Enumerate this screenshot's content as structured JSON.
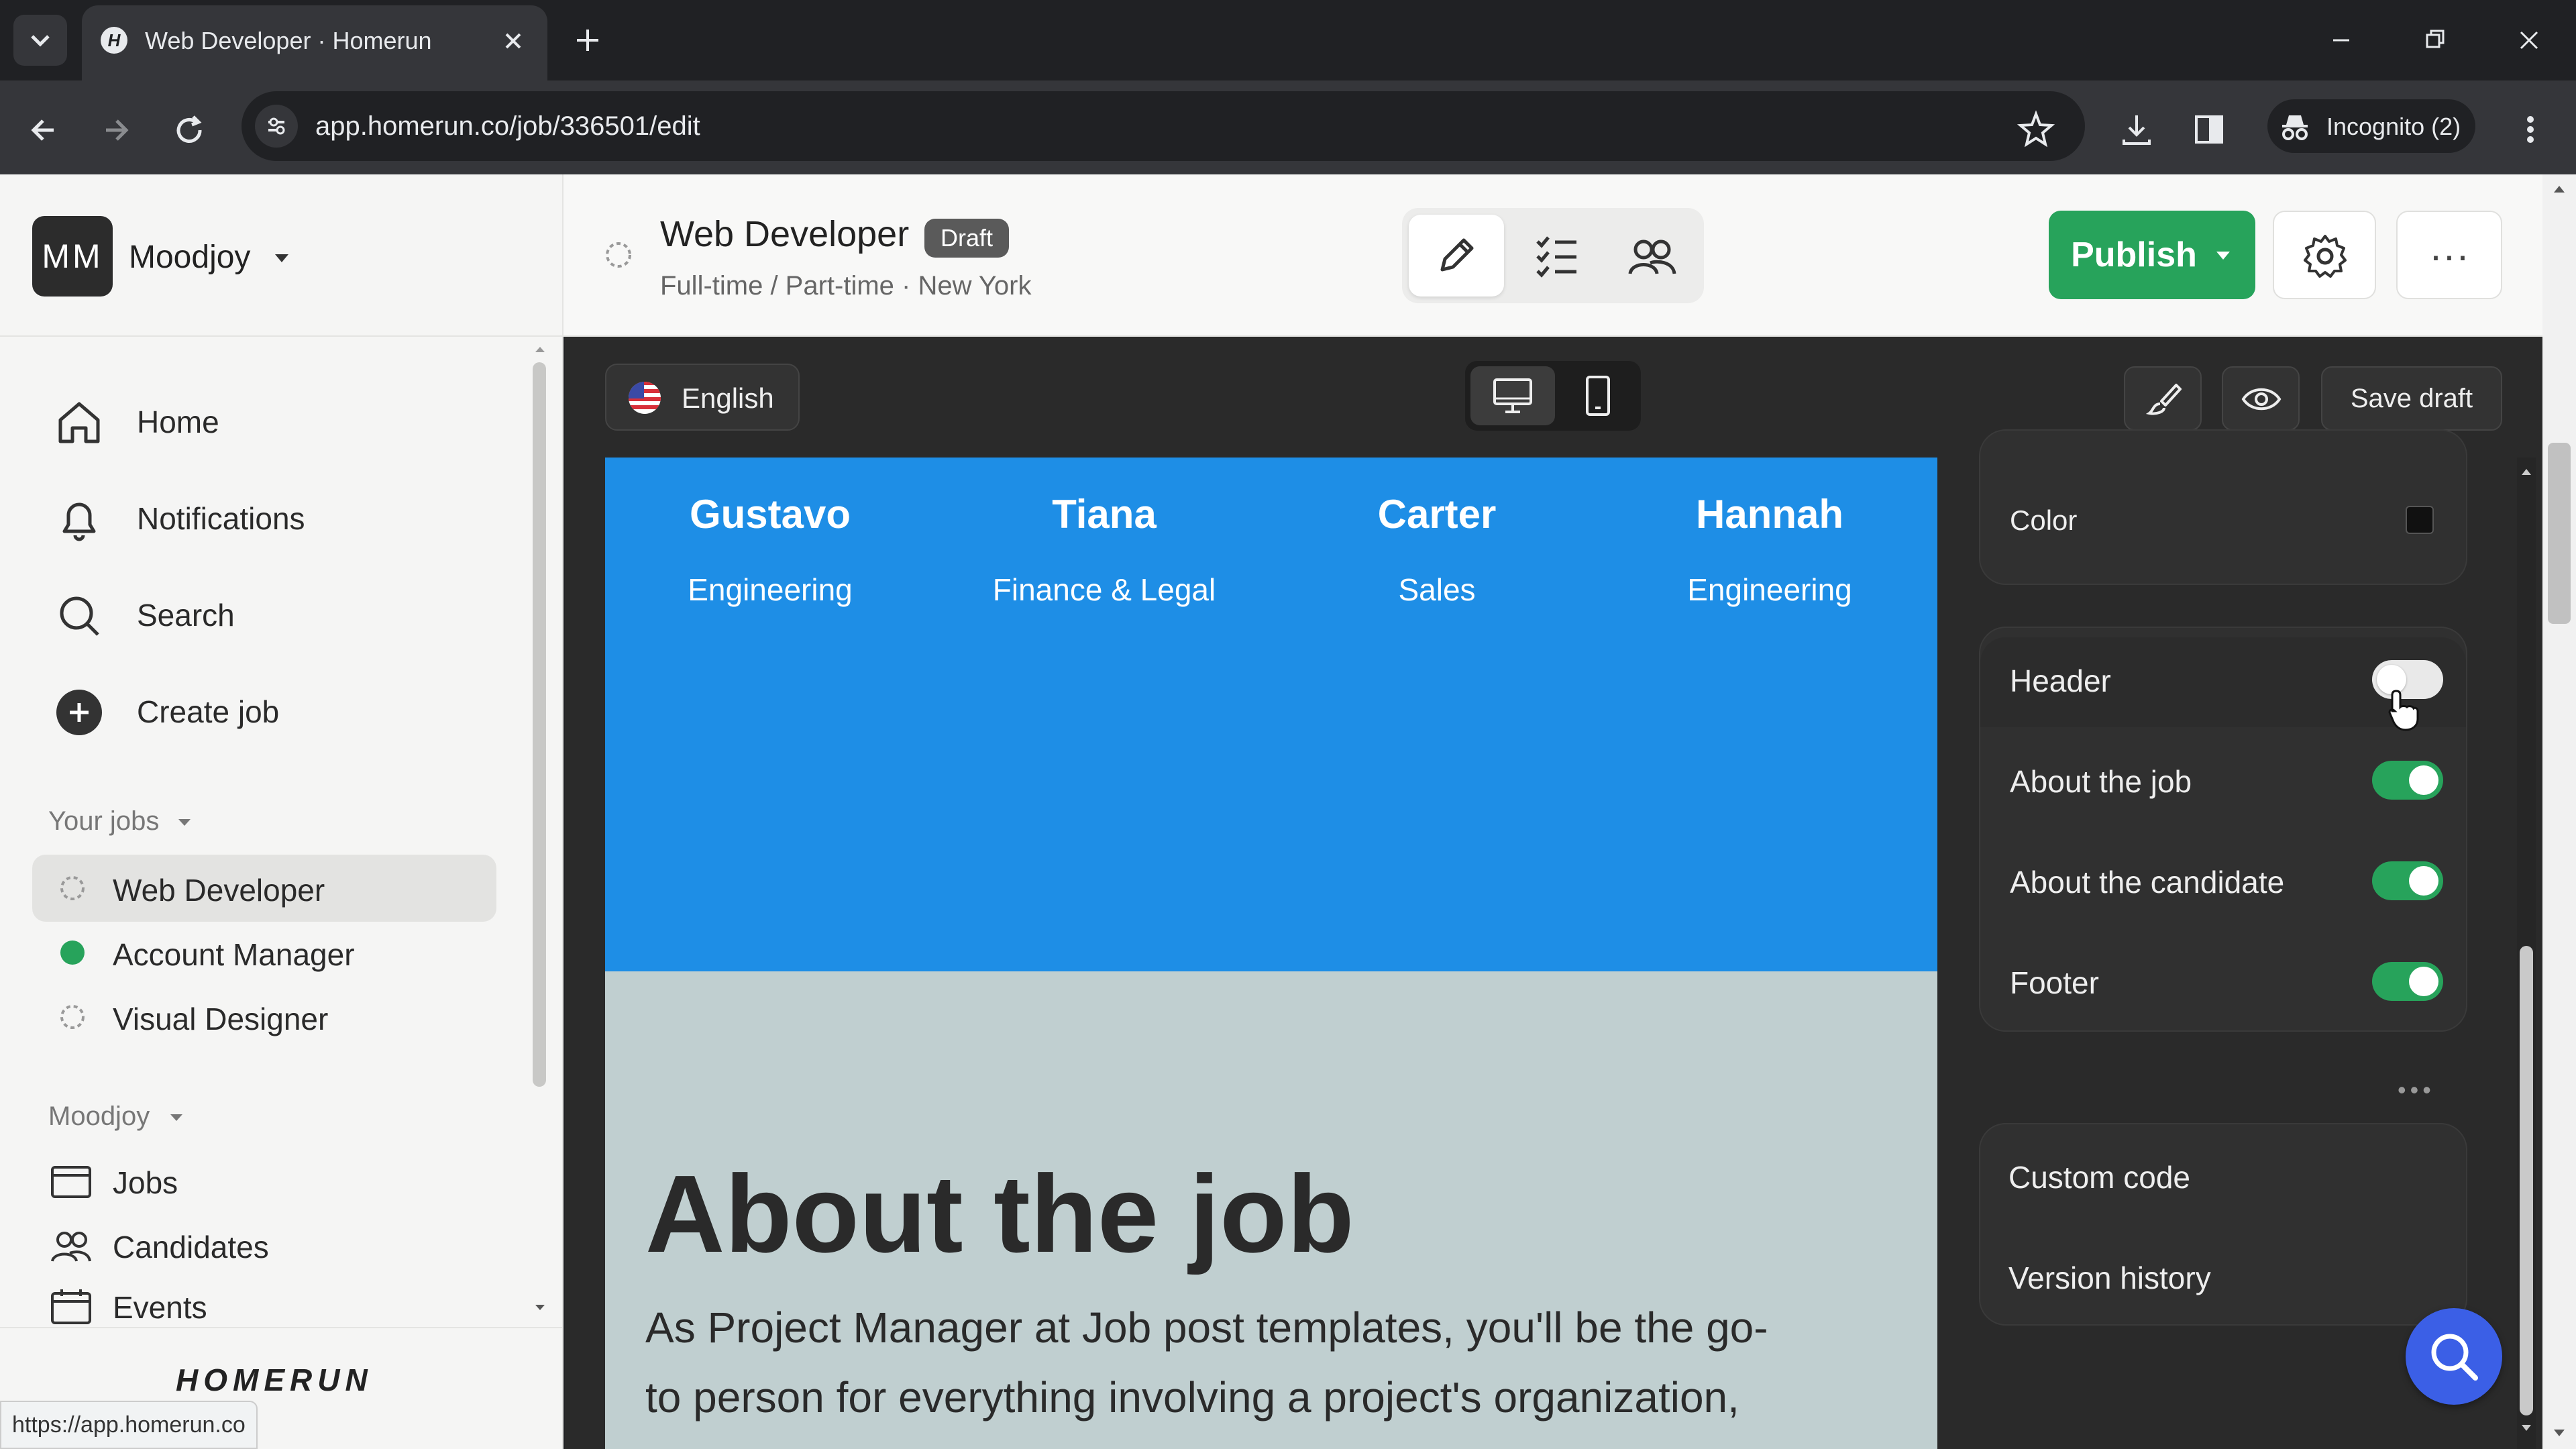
{
  "browser": {
    "tab_title": "Web Developer · Homerun",
    "url": "app.homerun.co/job/336501/edit",
    "incognito_label": "Incognito (2)",
    "status_url": "https://app.homerun.co"
  },
  "sidebar": {
    "org_initials": "MM",
    "org_name": "Moodjoy",
    "nav": [
      {
        "label": "Home",
        "icon": "home-icon"
      },
      {
        "label": "Notifications",
        "icon": "bell-icon"
      },
      {
        "label": "Search",
        "icon": "search-icon"
      },
      {
        "label": "Create job",
        "icon": "plus-circle-icon"
      }
    ],
    "your_jobs_label": "Your jobs",
    "jobs": [
      {
        "label": "Web Developer",
        "status": "draft",
        "active": true
      },
      {
        "label": "Account Manager",
        "status": "published",
        "active": false
      },
      {
        "label": "Visual Designer",
        "status": "draft",
        "active": false
      }
    ],
    "org_section_label": "Moodjoy",
    "org_links": [
      {
        "label": "Jobs",
        "icon": "jobs-icon"
      },
      {
        "label": "Candidates",
        "icon": "candidates-icon"
      },
      {
        "label": "Events",
        "icon": "calendar-icon"
      }
    ],
    "logo_text": "HOMERUN"
  },
  "header": {
    "job_title": "Web Developer",
    "badge": "Draft",
    "meta": "Full-time / Part-time · New York",
    "publish_label": "Publish",
    "more_label": "···"
  },
  "editor": {
    "language": "English",
    "save_draft_label": "Save draft"
  },
  "canvas": {
    "team": [
      {
        "name": "Gustavo",
        "dept": "Engineering"
      },
      {
        "name": "Tiana",
        "dept": "Finance & Legal"
      },
      {
        "name": "Carter",
        "dept": "Sales"
      },
      {
        "name": "Hannah",
        "dept": "Engineering"
      }
    ],
    "about_title": "About the job",
    "about_line1": "As Project Manager at Job post templates, you'll be the go-",
    "about_line2": "to person for everything involving a project's organization,"
  },
  "panel": {
    "color_label": "Color",
    "sections": [
      {
        "label": "Header",
        "enabled": false
      },
      {
        "label": "About the job",
        "enabled": true
      },
      {
        "label": "About the candidate",
        "enabled": true
      },
      {
        "label": "Footer",
        "enabled": true
      }
    ],
    "dots": "•••",
    "custom_code_label": "Custom code",
    "version_history_label": "Version history"
  },
  "colors": {
    "accent_green": "#27a35b",
    "team_band_blue": "#1e8ee6",
    "canvas_bg": "#c0cfd0",
    "fab_blue": "#3b5fe6"
  }
}
